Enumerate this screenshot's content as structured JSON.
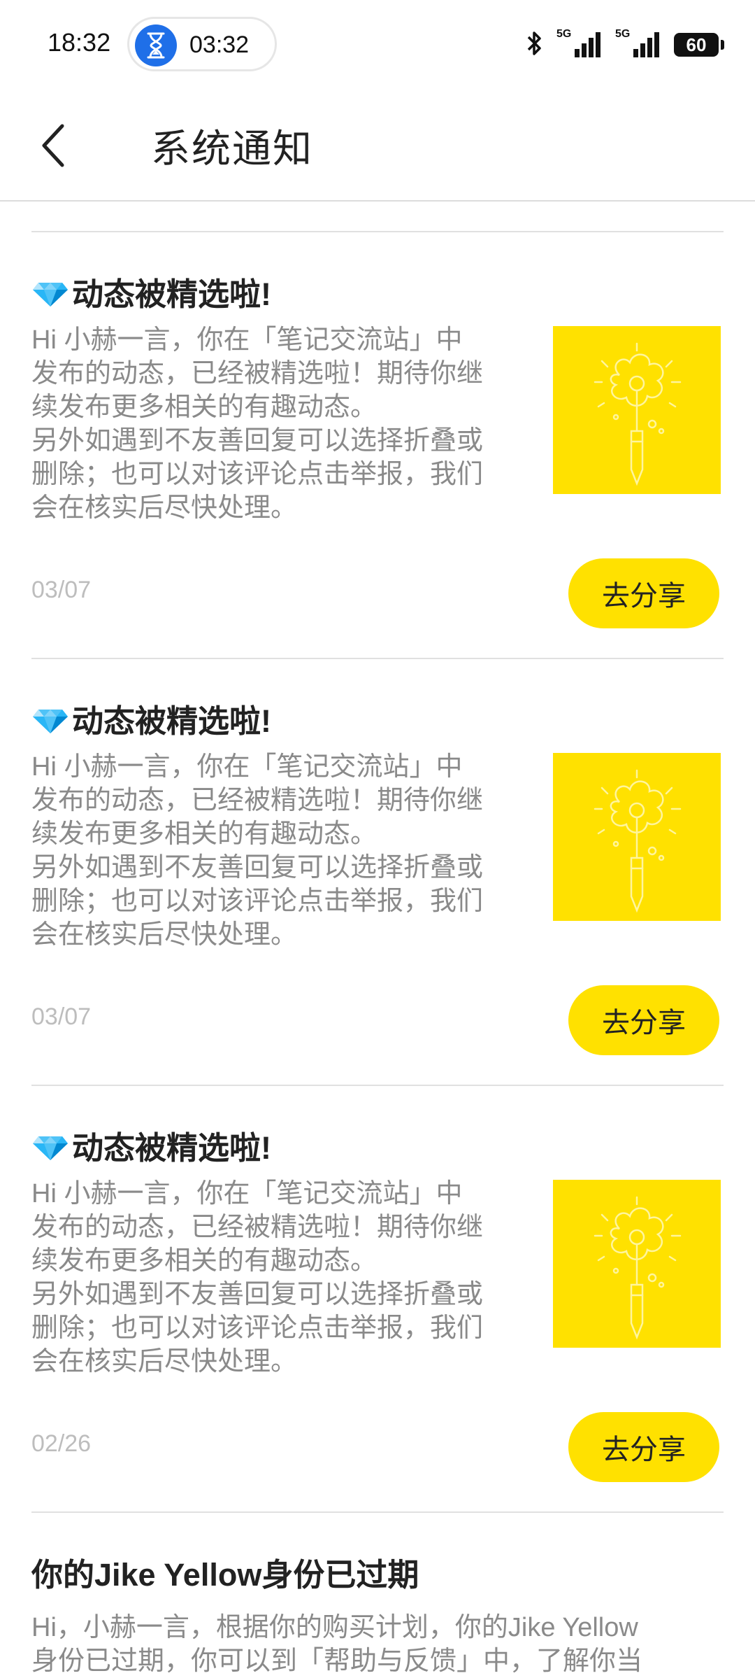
{
  "status_bar": {
    "time": "18:32",
    "timer": "03:32",
    "network_1": "5G",
    "network_2": "5G",
    "battery": "60",
    "icons": [
      "hourglass-icon",
      "bluetooth-icon",
      "signal-icon",
      "battery-icon"
    ]
  },
  "header": {
    "title": "系统通知",
    "back_icon": "chevron-left-icon"
  },
  "notifications": [
    {
      "emoji": "gem-icon",
      "title": "动态被精选啦!",
      "body": "Hi 小赫一言，你在「笔记交流站」中\n发布的动态，已经被精选啦！期待你继\n续发布更多相关的有趣动态。\n另外如遇到不友善回复可以选择折叠或\n删除；也可以对该评论点击举报，我们\n会在核实后尽快处理。",
      "date": "03/07",
      "action": "去分享"
    },
    {
      "emoji": "gem-icon",
      "title": "动态被精选啦!",
      "body": "Hi 小赫一言，你在「笔记交流站」中\n发布的动态，已经被精选啦！期待你继\n续发布更多相关的有趣动态。\n另外如遇到不友善回复可以选择折叠或\n删除；也可以对该评论点击举报，我们\n会在核实后尽快处理。",
      "date": "03/07",
      "action": "去分享"
    },
    {
      "emoji": "gem-icon",
      "title": "动态被精选啦!",
      "body": "Hi 小赫一言，你在「笔记交流站」中\n发布的动态，已经被精选啦！期待你继\n续发布更多相关的有趣动态。\n另外如遇到不友善回复可以选择折叠或\n删除；也可以对该评论点击举报，我们\n会在核实后尽快处理。",
      "date": "02/26",
      "action": "去分享"
    }
  ],
  "last_notification": {
    "title": "你的Jike Yellow身份已过期",
    "body": "Hi，小赫一言，根据你的购买计划，你的Jike Yellow\n身份已过期，你可以到「帮助与反馈」中，了解你当"
  },
  "colors": {
    "accent": "#ffe100",
    "timer_blue": "#1f6fe8",
    "body_text": "#8a8a8a",
    "date_text": "#bdbdbd"
  }
}
